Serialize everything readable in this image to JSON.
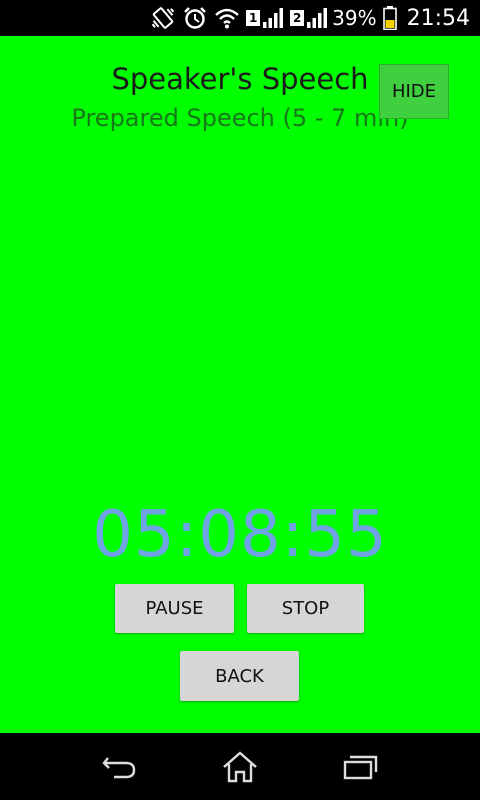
{
  "status_bar": {
    "battery_percent": "39%",
    "time": "21:54",
    "sim1": "1",
    "sim2": "2",
    "icons": [
      "vibrate-icon",
      "alarm-icon",
      "wifi-icon",
      "signal-sim1-icon",
      "signal-sim2-icon",
      "battery-icon"
    ]
  },
  "screen": {
    "background": "#00ff00",
    "title": "Speaker's Speech",
    "subtitle": "Prepared Speech (5 - 7 min)",
    "hide_label": "HIDE",
    "timer": "05:08:55",
    "timer_color": "#6fa3e6",
    "pause_label": "PAUSE",
    "stop_label": "STOP",
    "back_label": "BACK"
  },
  "nav_bar": {
    "icons": [
      "back-icon",
      "home-icon",
      "recent-apps-icon"
    ]
  }
}
